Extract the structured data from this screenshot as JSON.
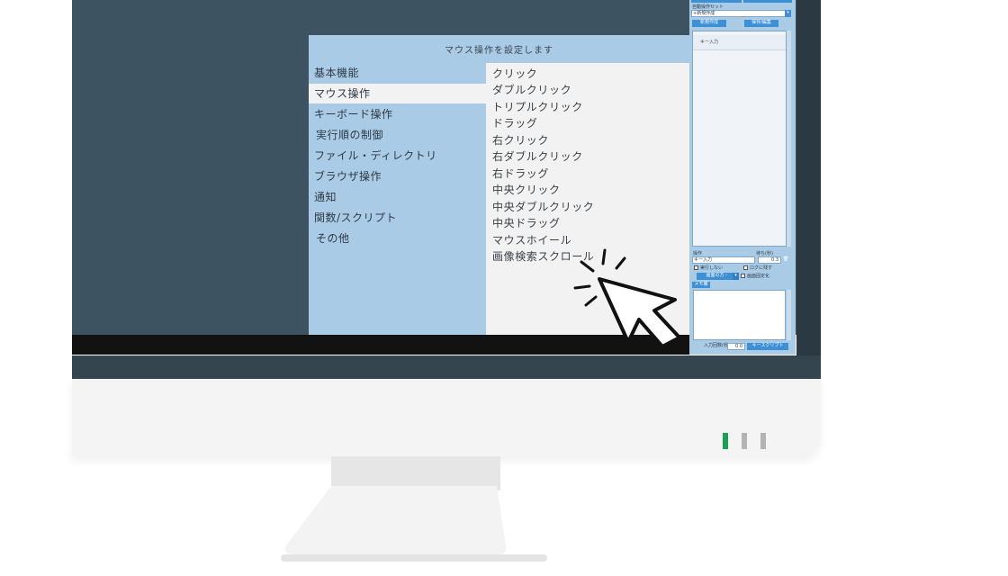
{
  "dialog": {
    "title": "マウス操作を設定します",
    "categories": [
      {
        "label": "基本機能"
      },
      {
        "label": "マウス操作"
      },
      {
        "label": "キーボード操作"
      },
      {
        "label": "実行順の制御"
      },
      {
        "label": "ファイル・ディレクトリ"
      },
      {
        "label": "ブラウザ操作"
      },
      {
        "label": "通知"
      },
      {
        "label": "関数/スクリプト"
      },
      {
        "label": "その他"
      }
    ],
    "selected_category": "マウス操作",
    "actions": [
      {
        "label": "クリック"
      },
      {
        "label": "ダブルクリック"
      },
      {
        "label": "トリプルクリック"
      },
      {
        "label": "ドラッグ"
      },
      {
        "label": "右クリック"
      },
      {
        "label": "右ダブルクリック"
      },
      {
        "label": "右ドラッグ"
      },
      {
        "label": "中央クリック"
      },
      {
        "label": "中央ダブルクリック"
      },
      {
        "label": "中央ドラッグ"
      },
      {
        "label": "マウスホイール"
      },
      {
        "label": "画像検索スクロール"
      }
    ]
  },
  "side_panel": {
    "set_label": "自動操作セット",
    "set_value": "+新規作成",
    "new_button": "新規作成",
    "save_button": "保存/編集",
    "list_item": "キー入力",
    "op_label": "操作",
    "wait_label": "待ち(秒)",
    "op_value": "キー入力",
    "wait_value": "0.3",
    "check_no_exec": "実行しない",
    "check_log": "ログに残す",
    "check_screen": "画面固定化",
    "screen_select": "画面の方・",
    "memo_label": "メモ欄",
    "repeat_label": "入力回数(秒)",
    "repeat_value": "0.0",
    "add_script_button": "キースクリプト"
  },
  "colors": {
    "screen": "#3e5361",
    "dialog_blue": "#a9cbe6",
    "list_bg": "#f2f2f2",
    "accent": "#3d8fd6",
    "led_on": "#1aa052",
    "led_off": "#b3b3b3"
  },
  "icons": [
    "cursor-arrow-icon",
    "click-burst-icon"
  ]
}
